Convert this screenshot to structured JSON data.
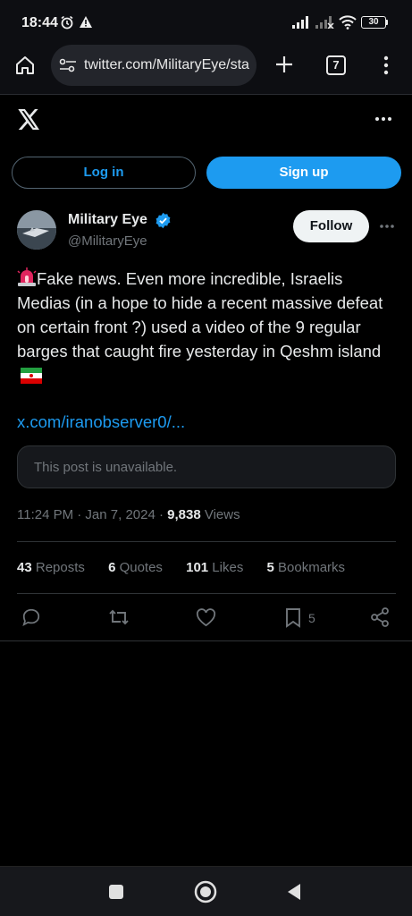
{
  "status_bar": {
    "time": "18:44",
    "battery": "30"
  },
  "browser": {
    "url": "twitter.com/MilitaryEye/sta",
    "tab_count": "7"
  },
  "header": {
    "logo": "x-logo-icon"
  },
  "auth": {
    "login_label": "Log in",
    "signup_label": "Sign up"
  },
  "author": {
    "name": "Military Eye",
    "handle": "@MilitaryEye",
    "follow_label": "Follow"
  },
  "tweet": {
    "text": "Fake news. Even more incredible, Israelis Medias (in a hope to hide a recent massive defeat on certain front ?) used a video of the 9 regular barges that caught fire yesterday in Qeshm island",
    "link": "x.com/iranobserver0/...",
    "unavailable": "This post is unavailable.",
    "timestamp": "11:24 PM · Jan 7, 2024 · ",
    "views_count": "9,838",
    "views_label": " Views"
  },
  "stats": [
    {
      "count": "43",
      "label": " Reposts"
    },
    {
      "count": "6",
      "label": " Quotes"
    },
    {
      "count": "101",
      "label": " Likes"
    },
    {
      "count": "5",
      "label": " Bookmarks"
    }
  ],
  "actions": {
    "bookmark_count": "5"
  },
  "colors": {
    "accent": "#1d9bf0",
    "background": "#000000",
    "muted": "#71767b"
  }
}
